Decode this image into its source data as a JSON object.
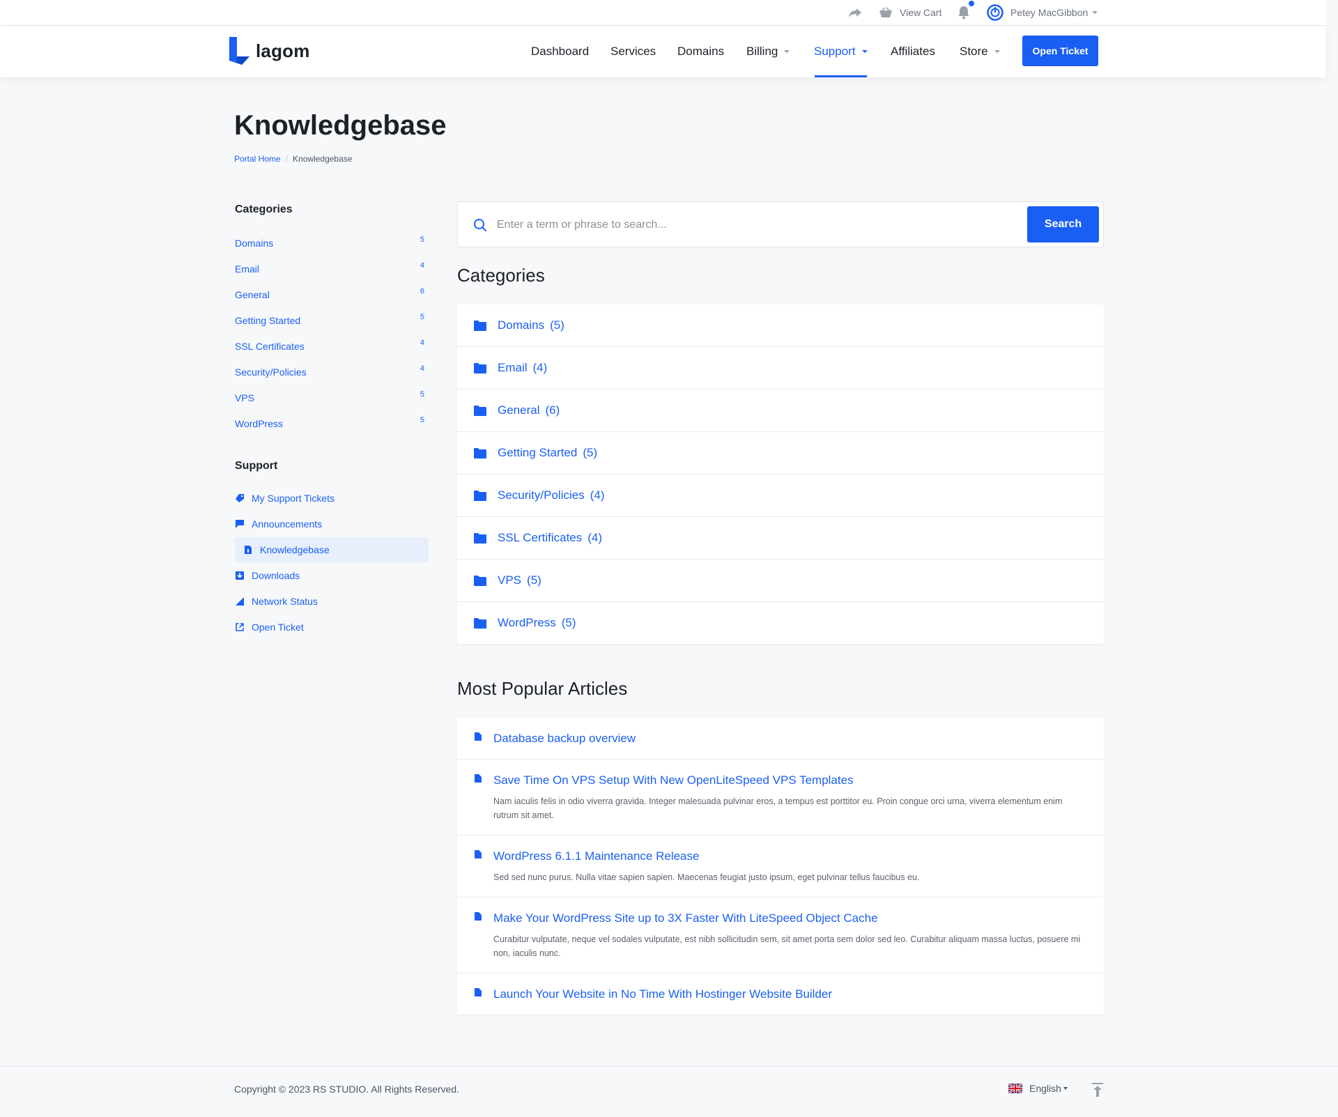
{
  "topbar": {
    "view_cart": "View Cart",
    "user_name": "Petey MacGibbon"
  },
  "brand": {
    "name": "lagom"
  },
  "nav": {
    "items": [
      {
        "label": "Dashboard"
      },
      {
        "label": "Services"
      },
      {
        "label": "Domains"
      },
      {
        "label": "Billing"
      },
      {
        "label": "Support",
        "active": true
      },
      {
        "label": "Affiliates"
      },
      {
        "label": "Store"
      }
    ],
    "cta": "Open Ticket"
  },
  "page": {
    "title": "Knowledgebase",
    "breadcrumb": [
      "Portal Home",
      "Knowledgebase"
    ]
  },
  "sidebar": {
    "categories_title": "Categories",
    "categories": [
      {
        "label": "Domains",
        "count": "5"
      },
      {
        "label": "Email",
        "count": "4"
      },
      {
        "label": "General",
        "count": "6"
      },
      {
        "label": "Getting Started",
        "count": "5"
      },
      {
        "label": "SSL Certificates",
        "count": "4"
      },
      {
        "label": "Security/Policies",
        "count": "4"
      },
      {
        "label": "VPS",
        "count": "5"
      },
      {
        "label": "WordPress",
        "count": "5"
      }
    ],
    "support_title": "Support",
    "support": [
      {
        "label": "My Support Tickets",
        "icon": "ticket-icon"
      },
      {
        "label": "Announcements",
        "icon": "flag-icon"
      },
      {
        "label": "Knowledgebase",
        "icon": "document-icon",
        "active": true
      },
      {
        "label": "Downloads",
        "icon": "download-icon"
      },
      {
        "label": "Network Status",
        "icon": "signal-icon"
      },
      {
        "label": "Open Ticket",
        "icon": "external-link-icon"
      }
    ]
  },
  "search": {
    "placeholder": "Enter a term or phrase to search...",
    "button": "Search"
  },
  "categories_section": {
    "title": "Categories",
    "items": [
      {
        "label": "Domains",
        "count": "(5)"
      },
      {
        "label": "Email",
        "count": "(4)"
      },
      {
        "label": "General",
        "count": "(6)"
      },
      {
        "label": "Getting Started",
        "count": "(5)"
      },
      {
        "label": "Security/Policies",
        "count": "(4)"
      },
      {
        "label": "SSL Certificates",
        "count": "(4)"
      },
      {
        "label": "VPS",
        "count": "(5)"
      },
      {
        "label": "WordPress",
        "count": "(5)"
      }
    ]
  },
  "articles_section": {
    "title": "Most Popular Articles",
    "items": [
      {
        "title": "Database backup overview",
        "desc": ""
      },
      {
        "title": "Save Time On VPS Setup With New OpenLiteSpeed VPS Templates",
        "desc": "Nam iaculis felis in odio viverra gravida. Integer malesuada pulvinar eros, a tempus est porttitor eu. Proin congue orci urna, viverra elementum enim rutrum sit amet."
      },
      {
        "title": "WordPress 6.1.1 Maintenance Release",
        "desc": "Sed sed nunc purus. Nulla vitae sapien sapien. Maecenas feugiat justo ipsum, eget pulvinar tellus faucibus eu."
      },
      {
        "title": "Make Your WordPress Site up to 3X Faster With LiteSpeed Object Cache",
        "desc": "Curabitur vulputate, neque vel sodales vulputate, est nibh sollicitudin sem, sit amet porta sem dolor sed leo. Curabitur aliquam massa luctus, posuere mi non, iaculis nunc."
      },
      {
        "title": "Launch Your Website in No Time With Hostinger Website Builder",
        "desc": ""
      }
    ]
  },
  "footer": {
    "copyright": "Copyright © 2023 RS STUDIO. All Rights Reserved.",
    "language": "English"
  },
  "colors": {
    "accent": "#1a5ff4",
    "text": "#1d2127",
    "muted": "#8a9099",
    "background": "#f7f8fa"
  }
}
